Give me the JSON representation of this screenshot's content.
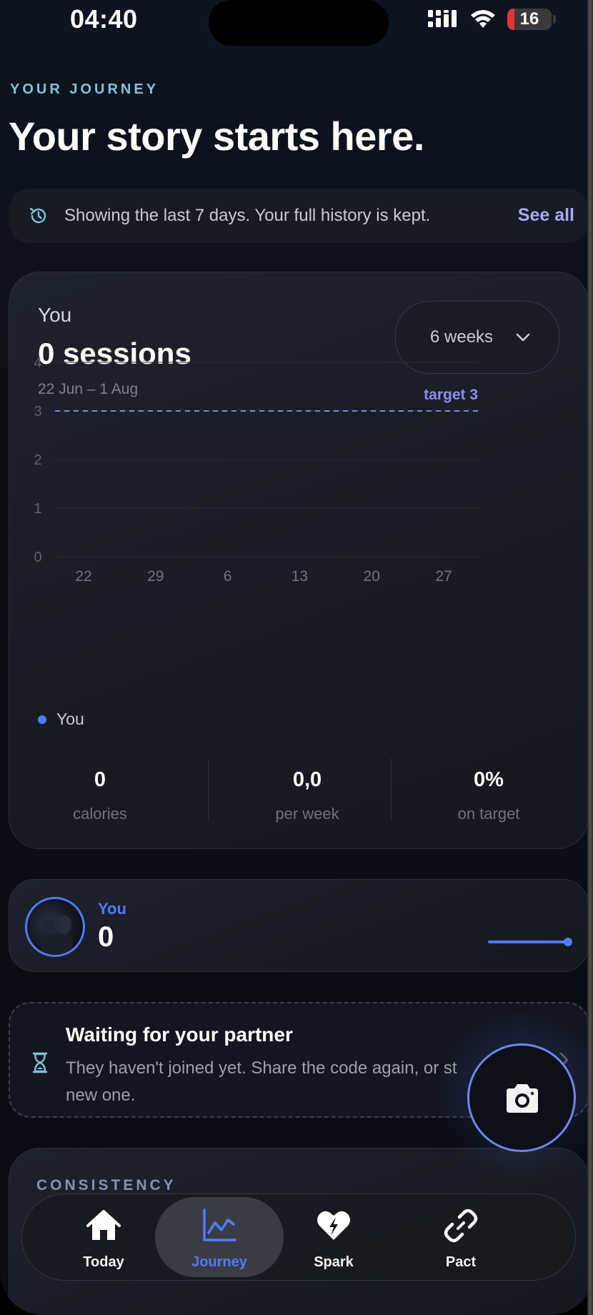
{
  "status_bar": {
    "time": "04:40",
    "battery": "16",
    "battery_level": 0.16
  },
  "header": {
    "eyebrow": "YOUR JOURNEY",
    "title": "Your story starts here."
  },
  "history_banner": {
    "icon": "history-icon",
    "text": "Showing the last 7 days. Your full history is kept.",
    "link": "See all"
  },
  "chart_card": {
    "label": "You",
    "count": "0 sessions",
    "date_range": "22 Jun – 1 Aug",
    "range_select": {
      "label": "6 weeks",
      "icon": "chevron-down-icon"
    },
    "legend": "You",
    "stats": [
      {
        "value": "0",
        "label": "calories"
      },
      {
        "value": "0,0",
        "label": "per week"
      },
      {
        "value": "0%",
        "label": "on target"
      }
    ]
  },
  "chart_data": {
    "type": "line",
    "x_tick_labels": [
      "22",
      "29",
      "6",
      "13",
      "20",
      "27"
    ],
    "y_ticks": [
      0,
      1,
      2,
      3,
      4
    ],
    "ylim": [
      0,
      4
    ],
    "series": [
      {
        "name": "You",
        "values": [
          0,
          0,
          0,
          0,
          0,
          0
        ],
        "color": "#4f7bf7"
      }
    ],
    "target": {
      "value": 3,
      "label": "target 3",
      "color": "#8e8ff0"
    },
    "grid": true,
    "legend_position": "bottom-left"
  },
  "member": {
    "name": "You",
    "value": "0",
    "progress": 0,
    "accent": "#4f7bf7"
  },
  "waiting": {
    "title": "Waiting for your partner",
    "text": "They haven't joined yet. Share the code again, or st",
    "text_line2": "new one.",
    "icon": "hourglass-icon"
  },
  "camera_button": {
    "icon": "camera-icon"
  },
  "consistency": {
    "title": "CONSISTENCY"
  },
  "tabs": [
    {
      "label": "Today",
      "icon": "home-icon",
      "active": false
    },
    {
      "label": "Journey",
      "icon": "chart-line-icon",
      "active": true
    },
    {
      "label": "Spark",
      "icon": "heart-bolt-icon",
      "active": false
    },
    {
      "label": "Pact",
      "icon": "link-icon",
      "active": false
    }
  ],
  "colors": {
    "accent": "#4f7bf7",
    "target": "#8e8ff0",
    "eyebrow": "#7fc4d6",
    "battery_low": "#e5333a"
  }
}
